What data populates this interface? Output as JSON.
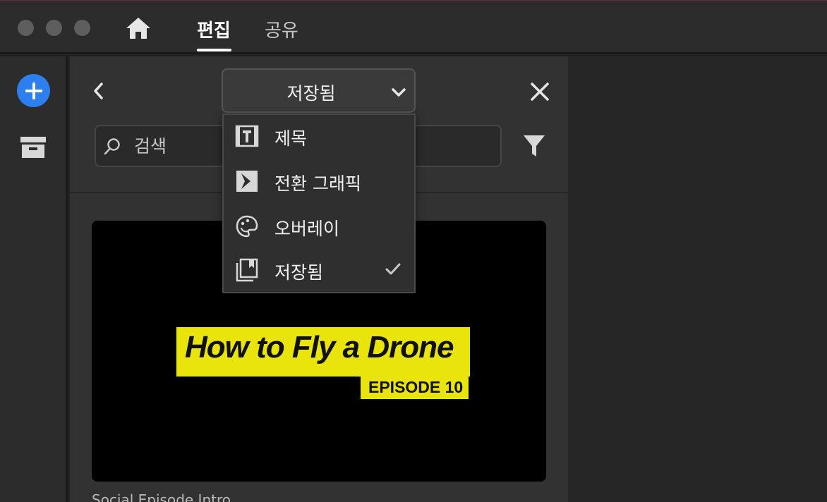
{
  "titlebar": {
    "tabs": [
      {
        "label": "편집",
        "active": true
      },
      {
        "label": "공유",
        "active": false
      }
    ]
  },
  "panel": {
    "dropdown": {
      "selected": "저장됨"
    },
    "search": {
      "placeholder": "검색"
    },
    "menu": {
      "items": [
        {
          "label": "제목",
          "icon": "title-icon",
          "checked": false
        },
        {
          "label": "전환 그래픽",
          "icon": "transition-icon",
          "checked": false
        },
        {
          "label": "오버레이",
          "icon": "overlay-icon",
          "checked": false
        },
        {
          "label": "저장됨",
          "icon": "saved-icon",
          "checked": true
        }
      ]
    },
    "template": {
      "title": "How to Fly a Drone",
      "subtitle": "EPISODE 10",
      "caption": "Social Episode Intro"
    }
  },
  "colors": {
    "accent": "#2d7ff0",
    "highlight": "#e8e40c"
  }
}
